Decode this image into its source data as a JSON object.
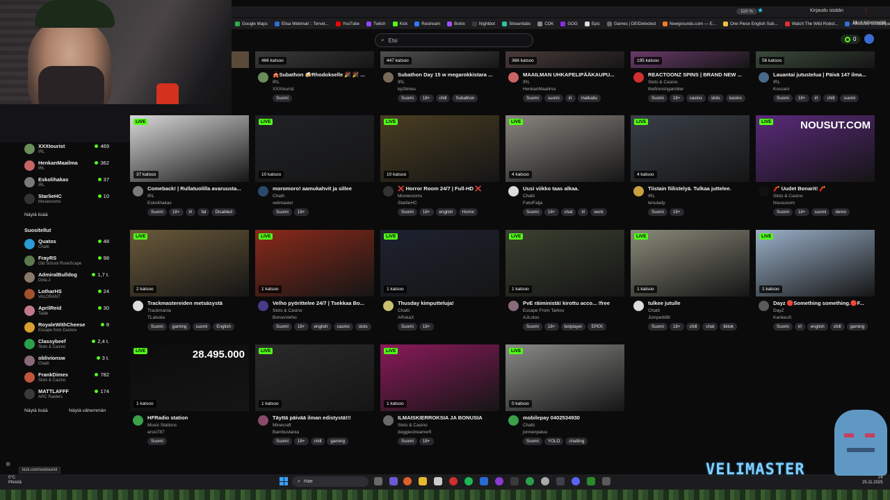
{
  "browser": {
    "zoom": "110 %",
    "login": "Kirjaudu sisään",
    "bookmarks": [
      {
        "label": "Google Maps",
        "color": "#34a853"
      },
      {
        "label": "Elisa Webmail :: Tervet...",
        "color": "#2b6fd6"
      },
      {
        "label": "YouTube",
        "color": "#ff0000"
      },
      {
        "label": "Twitch",
        "color": "#9146ff"
      },
      {
        "label": "Kick",
        "color": "#53fc18"
      },
      {
        "label": "Restream",
        "color": "#2f7bff"
      },
      {
        "label": "Botrix",
        "color": "#a050ff"
      },
      {
        "label": "Nightbot",
        "color": "#3a3a3a"
      },
      {
        "label": "Streamlabs",
        "color": "#31c3a2"
      },
      {
        "label": "CDK",
        "color": "#888888"
      },
      {
        "label": "GOG",
        "color": "#8a2be2"
      },
      {
        "label": "Epic",
        "color": "#dddddd"
      },
      {
        "label": "Games | DEIDetected",
        "color": "#666666"
      },
      {
        "label": "Newgrounds.com — E...",
        "color": "#f47b20"
      },
      {
        "label": "One Piece English Sub...",
        "color": "#f0c040"
      },
      {
        "label": "Watch The Wild Robot...",
        "color": "#e03030"
      },
      {
        "label": "Aikuisten sosiaalipalve...",
        "color": "#3070d0"
      }
    ],
    "bookmarks_folder": "Muut kirjanmerkit"
  },
  "search": {
    "placeholder": "Etsi"
  },
  "kicks": {
    "count": "0"
  },
  "sidebar": {
    "following": [
      {
        "name": "XXXtourist",
        "cat": "IRL",
        "viewers": "469",
        "color": "#6a8d5a"
      },
      {
        "name": "HenkanMaailma",
        "cat": "IRL",
        "viewers": "362",
        "color": "#c86464"
      },
      {
        "name": "Eskolihakas",
        "cat": "IRL",
        "viewers": "37",
        "color": "#7a7a7a"
      },
      {
        "name": "StarlieHC",
        "cat": "Movierooms",
        "viewers": "10",
        "color": "#333333"
      }
    ],
    "show_more_1": "Näytä lisää",
    "recommended_heading": "Suositellut",
    "recommended": [
      {
        "name": "Quatos",
        "cat": "Chatti",
        "viewers": "48",
        "color": "#2b9bd6"
      },
      {
        "name": "FrayRS",
        "cat": "Old School RuneScape",
        "viewers": "98",
        "color": "#5a7a4a"
      },
      {
        "name": "AdmiralBulldog",
        "cat": "Dota 2",
        "viewers": "1,7 t.",
        "color": "#8a7a6a"
      },
      {
        "name": "LotharHS",
        "cat": "VALORANT",
        "viewers": "24",
        "color": "#a0522d"
      },
      {
        "name": "AprilReid",
        "cat": "Taide",
        "viewers": "30",
        "color": "#c07a8a"
      },
      {
        "name": "RoyaleWithCheese",
        "cat": "Escape from Duckov",
        "viewers": "8",
        "color": "#d8a030"
      },
      {
        "name": "Classybeef",
        "cat": "Slots & Casino",
        "viewers": "2,4 t.",
        "color": "#2aa04a"
      },
      {
        "name": "oblivionsw",
        "cat": "Chatti",
        "viewers": "3 t.",
        "color": "#8a6a7a"
      },
      {
        "name": "FrankDimes",
        "cat": "Slots & Casino",
        "viewers": "782",
        "color": "#c0563a"
      },
      {
        "name": "MATTLAFFF",
        "cat": "ARC Raiders",
        "viewers": "174",
        "color": "#3a3a3a"
      }
    ],
    "show_more_2": "Näytä lisää",
    "show_less": "Näytä vähemmän"
  },
  "cards": [
    {
      "viewers": "466 katsoo",
      "live": "",
      "title": "🎪Subathon 🍻Rhodokselle 🎉 🎉 ...",
      "cat": "IRL",
      "name": "XXXtourist",
      "tags": [
        "Suomi"
      ],
      "thumb": "#3a3a3a",
      "av": "#6a8d5a"
    },
    {
      "viewers": "447 katsoo",
      "live": "",
      "title": "Subathon Day 15 w megarokkistara ...",
      "cat": "IRL",
      "name": "kp2times",
      "tags": [
        "Suomi",
        "18+",
        "chill",
        "Subathon"
      ],
      "thumb": "#505050",
      "av": "#7a6a5a"
    },
    {
      "viewers": "366 katsoo",
      "live": "",
      "title": "MAAILMAN UHKAPELIPÄÄKAUPU...",
      "cat": "IRL",
      "name": "HenkanMaailma",
      "tags": [
        "Suomi",
        "suomi",
        "irl",
        "matkailu"
      ],
      "thumb": "#4a3a3a",
      "av": "#c86464"
    },
    {
      "viewers": "195 katsoo",
      "live": "",
      "title": "REACTOONZ SPINS | BRAND NEW ...",
      "cat": "Slots & Casino",
      "name": "thefinnishgambler",
      "tags": [
        "Suomi",
        "18+",
        "casino",
        "slots",
        "kasino"
      ],
      "thumb": "#6a3a6a",
      "av": "#d03030"
    },
    {
      "viewers": "56 katsoo",
      "live": "",
      "title": "Lauantai jutustelua | Päivä 147 ilma...",
      "cat": "IRL",
      "name": "Kossani",
      "tags": [
        "Suomi",
        "18+",
        "irl",
        "chill",
        "suomi"
      ],
      "thumb": "#3a4a3a",
      "av": "#4a6a8a"
    },
    {
      "viewers": "37 katsoo",
      "live": "LIVE",
      "title": "Comeback! | Rullatuolilla avaruusta...",
      "cat": "IRL",
      "name": "Eskolihakas",
      "tags": [
        "Suomi",
        "18+",
        "irl",
        "fat",
        "Disabled"
      ],
      "thumb": "#d8d8d8",
      "av": "#7a7a7a"
    },
    {
      "viewers": "10 katsoo",
      "live": "LIVE",
      "title": "moromoro! aamukahvit ja sillee",
      "cat": "Chatti",
      "name": "velimaster",
      "tags": [
        "Suomi",
        "18+"
      ],
      "thumb": "#202226",
      "av": "#2a4a6a"
    },
    {
      "viewers": "10 katsoo",
      "live": "LIVE",
      "title": "❌ Horror Room 24/7 | Full-HD ❌",
      "cat": "Movierooms",
      "name": "StarlieHC",
      "tags": [
        "Suomi",
        "18+",
        "english",
        "Horror"
      ],
      "thumb": "#4a3e22",
      "av": "#333333"
    },
    {
      "viewers": "4 katsoo",
      "live": "LIVE",
      "title": "Uusi viikko taas alkaa.",
      "cat": "Chatti",
      "name": "FatsiFalja",
      "tags": [
        "Suomi",
        "18+",
        "chat",
        "irl",
        "work"
      ],
      "thumb": "#8a8580",
      "av": "#dddddd"
    },
    {
      "viewers": "4 katsoo",
      "live": "LIVE",
      "title": "Tiistain fiilistelyä. Tulkaa juttelee.",
      "cat": "IRL",
      "name": "tenulady",
      "tags": [
        "Suomi",
        "18+"
      ],
      "thumb": "#3a4048",
      "av": "#c8a040"
    },
    {
      "viewers": "",
      "live": "LIVE",
      "title": "🧨 Uudet Bonarit! 🧨",
      "cat": "Slots & Casino",
      "name": "Nousucom",
      "tags": [
        "Suomi",
        "18+",
        "suomi",
        "demo"
      ],
      "thumb": "#5a2a7a",
      "av": "#111111",
      "overlay": "NOUSUT.COM"
    },
    {
      "viewers": "2 katsoo",
      "live": "LIVE",
      "title": "Trackmastereiden metsäsystä",
      "cat": "Trackmania",
      "name": "TLatvala",
      "tags": [
        "Suomi",
        "gaming",
        "suomi",
        "English"
      ],
      "thumb": "#6a5a3a",
      "av": "#dddddd"
    },
    {
      "viewers": "1 katsoo",
      "live": "LIVE",
      "title": "Velho pyörittelee 24/7 | Tsekkaa Bo...",
      "cat": "Slots & Casino",
      "name": "BonusVelho",
      "tags": [
        "Suomi",
        "18+",
        "english",
        "casino",
        "slots"
      ],
      "thumb": "#8a2a1a",
      "av": "#4a3a8a"
    },
    {
      "viewers": "1 katsoo",
      "live": "LIVE",
      "title": "Thusday kimputteluja!",
      "cat": "Chatti",
      "name": "ARskaX",
      "tags": [
        "Suomi",
        "18+"
      ],
      "thumb": "#1e2230",
      "av": "#c8c070"
    },
    {
      "viewers": "1 katsoo",
      "live": "LIVE",
      "title": "PvE räiministä! kirottu acco... !free",
      "cat": "Escape From Tarkov",
      "name": "AJLotus",
      "tags": [
        "Suomi",
        "18+",
        "botplayer",
        "EPEK"
      ],
      "thumb": "#3a4030",
      "av": "#8a6a7a"
    },
    {
      "viewers": "1 katsoo",
      "live": "LIVE",
      "title": "tulkee jutulle",
      "cat": "Chatti",
      "name": "Jompetti89",
      "tags": [
        "Suomi",
        "18+",
        "chill",
        "chat",
        "tiktok"
      ],
      "thumb": "#8a8a7a",
      "av": "#dddddd"
    },
    {
      "viewers": "1 katsoo",
      "live": "LIVE",
      "title": "Dayz 🔴Something something.🔴F...",
      "cat": "DayZ",
      "name": "KankeuS",
      "tags": [
        "Suomi",
        "irl",
        "english",
        "chill",
        "gaming"
      ],
      "thumb": "#9ab0c8",
      "av": "#5a5a5a"
    },
    {
      "viewers": "1 katsoo",
      "live": "LIVE",
      "title": "HFRadio station",
      "cat": "Music Stations",
      "name": "arssi787",
      "tags": [
        "Suomi"
      ],
      "thumb": "#0c0c0c",
      "av": "#3aa04a",
      "overlay": "28.495.000"
    },
    {
      "viewers": "1 katsoo",
      "live": "LIVE",
      "title": "Täyttä päivää ilman edistystä!!!",
      "cat": "Minecraft",
      "name": "Bambustania",
      "tags": [
        "Suomi",
        "18+",
        "chill",
        "gaming"
      ],
      "thumb": "#2a2a2a",
      "av": "#8a4a6a"
    },
    {
      "viewers": "1 katsoo",
      "live": "LIVE",
      "title": "ILMAISKIERROKSIA JA BONUSIA",
      "cat": "Slots & Casino",
      "name": "doggiestreamerfi",
      "tags": [
        "Suomi",
        "18+"
      ],
      "thumb": "#8a1a5a",
      "av": "#6a6a6a"
    },
    {
      "viewers": "0 katsoo",
      "live": "LIVE",
      "title": "mobilepay 0402534930",
      "cat": "Chatti",
      "name": "jonnenpaluu",
      "tags": [
        "Suomi",
        "YOLO",
        "chatting"
      ],
      "thumb": "#8a8a88",
      "av": "#3aa04a"
    }
  ],
  "status_url": "kick.com/xxxtourist",
  "taskbar": {
    "weather": "0°C",
    "weather_desc": "Pilvistä",
    "search": "Hae",
    "time": "24",
    "date": "25.11.2025"
  },
  "overlay_brand": "VELIMASTER"
}
